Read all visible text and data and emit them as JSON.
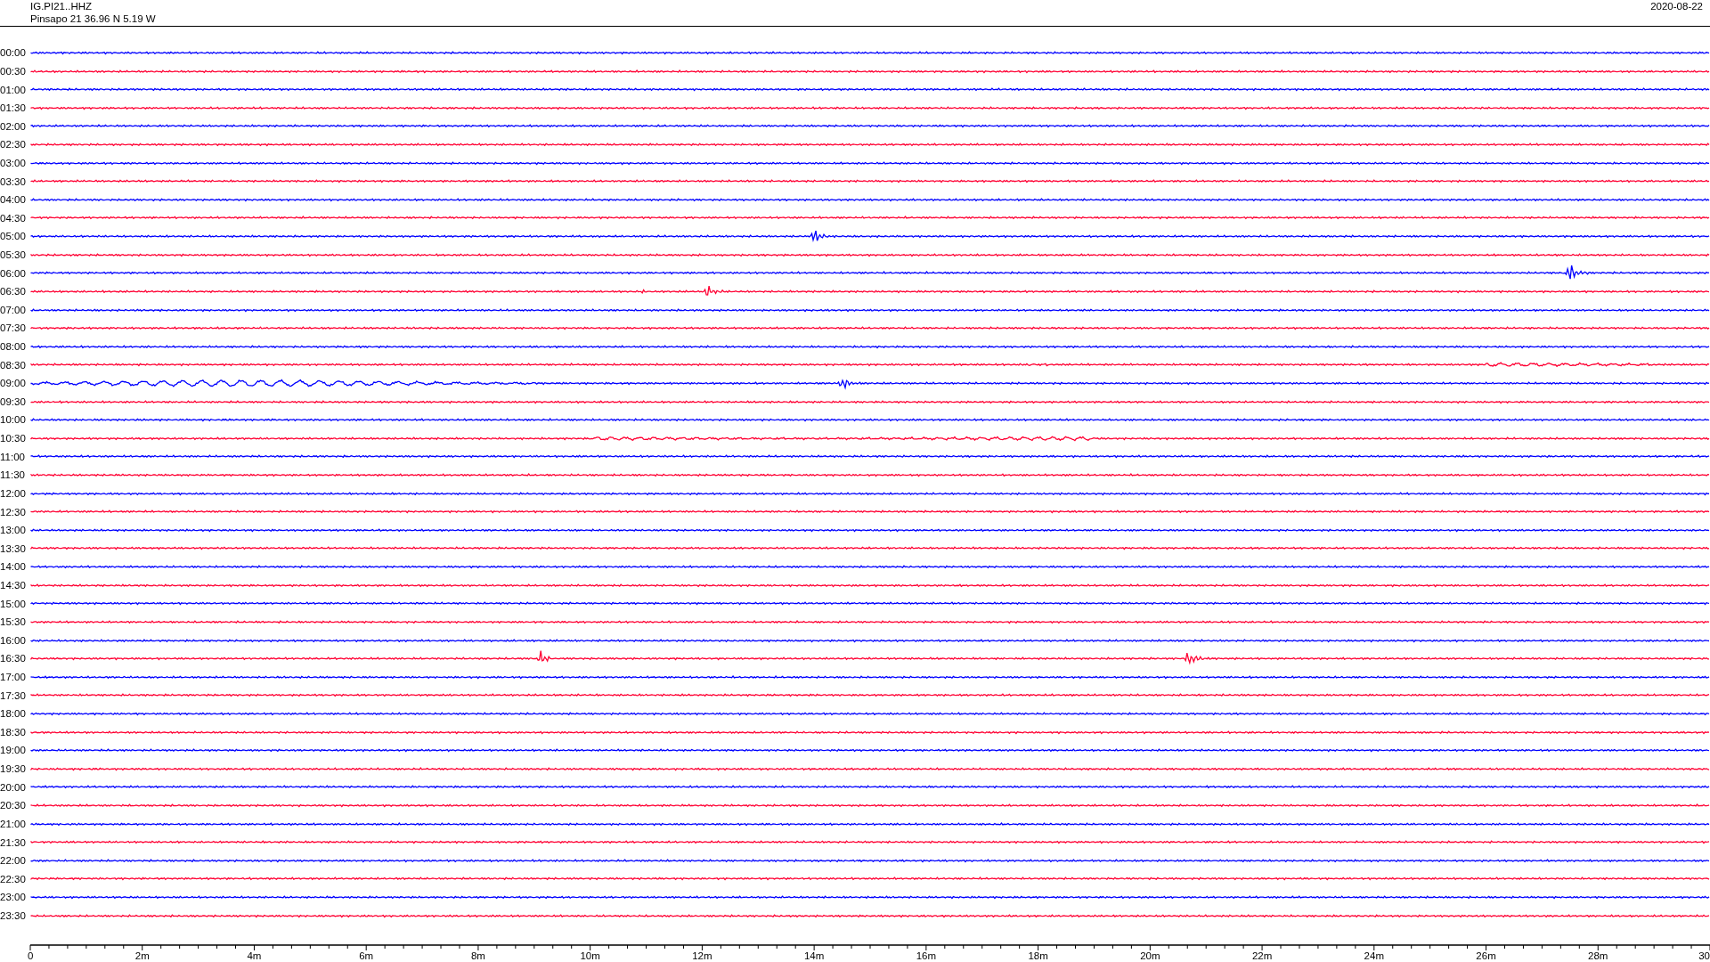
{
  "header": {
    "station": "IG.PI21..HHZ",
    "location": "Pinsapo 21  36.96 N 5.19 W",
    "date": "2020-08-22"
  },
  "rows": [
    {
      "label": "00:00",
      "color": "#0000ff"
    },
    {
      "label": "00:30",
      "color": "#ff0033"
    },
    {
      "label": "01:00",
      "color": "#0000ff"
    },
    {
      "label": "01:30",
      "color": "#ff0033"
    },
    {
      "label": "02:00",
      "color": "#0000ff"
    },
    {
      "label": "02:30",
      "color": "#ff0033"
    },
    {
      "label": "03:00",
      "color": "#0000ff"
    },
    {
      "label": "03:30",
      "color": "#ff0033"
    },
    {
      "label": "04:00",
      "color": "#0000ff"
    },
    {
      "label": "04:30",
      "color": "#ff0033"
    },
    {
      "label": "05:00",
      "color": "#0000ff"
    },
    {
      "label": "05:30",
      "color": "#ff0033"
    },
    {
      "label": "06:00",
      "color": "#0000ff"
    },
    {
      "label": "06:30",
      "color": "#ff0033"
    },
    {
      "label": "07:00",
      "color": "#0000ff"
    },
    {
      "label": "07:30",
      "color": "#ff0033"
    },
    {
      "label": "08:00",
      "color": "#0000ff"
    },
    {
      "label": "08:30",
      "color": "#ff0033"
    },
    {
      "label": "09:00",
      "color": "#0000ff"
    },
    {
      "label": "09:30",
      "color": "#ff0033"
    },
    {
      "label": "10:00",
      "color": "#0000ff"
    },
    {
      "label": "10:30",
      "color": "#ff0033"
    },
    {
      "label": "11:00",
      "color": "#0000ff"
    },
    {
      "label": "11:30",
      "color": "#ff0033"
    },
    {
      "label": "12:00",
      "color": "#0000ff"
    },
    {
      "label": "12:30",
      "color": "#ff0033"
    },
    {
      "label": "13:00",
      "color": "#0000ff"
    },
    {
      "label": "13:30",
      "color": "#ff0033"
    },
    {
      "label": "14:00",
      "color": "#0000ff"
    },
    {
      "label": "14:30",
      "color": "#ff0033"
    },
    {
      "label": "15:00",
      "color": "#0000ff"
    },
    {
      "label": "15:30",
      "color": "#ff0033"
    },
    {
      "label": "16:00",
      "color": "#0000ff"
    },
    {
      "label": "16:30",
      "color": "#ff0033"
    },
    {
      "label": "17:00",
      "color": "#0000ff"
    },
    {
      "label": "17:30",
      "color": "#ff0033"
    },
    {
      "label": "18:00",
      "color": "#0000ff"
    },
    {
      "label": "18:30",
      "color": "#ff0033"
    },
    {
      "label": "19:00",
      "color": "#0000ff"
    },
    {
      "label": "19:30",
      "color": "#ff0033"
    },
    {
      "label": "20:00",
      "color": "#0000ff"
    },
    {
      "label": "20:30",
      "color": "#ff0033"
    },
    {
      "label": "21:00",
      "color": "#0000ff"
    },
    {
      "label": "21:30",
      "color": "#ff0033"
    },
    {
      "label": "22:00",
      "color": "#0000ff"
    },
    {
      "label": "22:30",
      "color": "#ff0033"
    },
    {
      "label": "23:00",
      "color": "#0000ff"
    },
    {
      "label": "23:30",
      "color": "#ff0033"
    }
  ],
  "time_axis": {
    "labels": [
      "0",
      "2m",
      "4m",
      "6m",
      "8m",
      "10m",
      "12m",
      "14m",
      "16m",
      "18m",
      "20m",
      "22m",
      "24m",
      "26m",
      "28m",
      "30"
    ]
  }
}
